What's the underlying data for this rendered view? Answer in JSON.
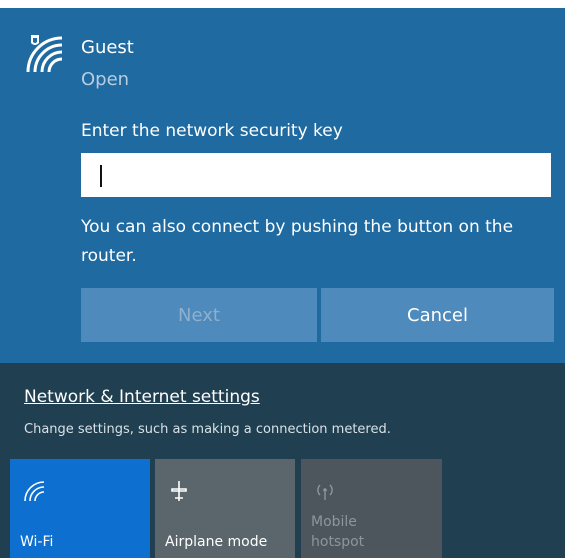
{
  "network": {
    "name": "Guest",
    "status": "Open",
    "prompt": "Enter the network security key",
    "key_value": "",
    "hint": "You can also connect by pushing the button on the router."
  },
  "buttons": {
    "next_label": "Next",
    "cancel_label": "Cancel"
  },
  "settings": {
    "link_label": "Network & Internet settings",
    "subtitle": "Change settings, such as making a connection metered."
  },
  "quick_actions": {
    "wifi": {
      "label": "Wi-Fi",
      "icon": "wifi-icon",
      "active": true
    },
    "airplane": {
      "label": "Airplane mode",
      "icon": "airplane-icon",
      "active": false
    },
    "hotspot": {
      "label_line1": "Mobile",
      "label_line2": "hotspot",
      "icon": "hotspot-icon",
      "active": false
    }
  },
  "colors": {
    "card_background": "#1f6aa0",
    "panel_background": "#203f50",
    "active_tile": "#0d6fd0"
  }
}
